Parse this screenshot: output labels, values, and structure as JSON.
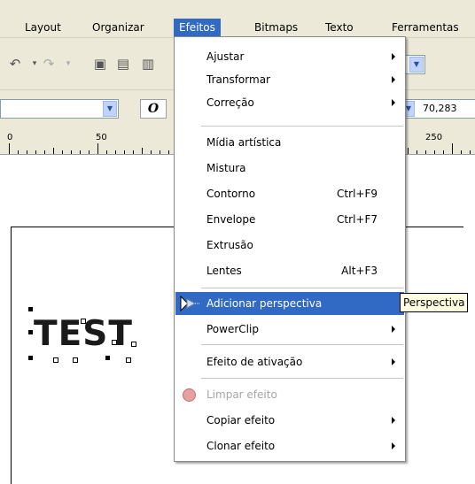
{
  "menubar": {
    "items": [
      {
        "label": "Layout"
      },
      {
        "label": "Organizar"
      },
      {
        "label": "Efeitos"
      },
      {
        "label": "Bitmaps"
      },
      {
        "label": "Texto"
      },
      {
        "label": "Ferramentas"
      }
    ]
  },
  "toolbar": {
    "width_value": "70,283",
    "italic_label": "O",
    "undo_icon": "undo-icon",
    "redo_icon": "redo-icon"
  },
  "ruler": {
    "labels": [
      "0",
      "50",
      "250"
    ]
  },
  "canvas": {
    "text": "TEST"
  },
  "menu": {
    "items": [
      {
        "label": "Ajustar",
        "shortcut": "",
        "submenu": true
      },
      {
        "label": "Transformar",
        "shortcut": "",
        "submenu": true
      },
      {
        "label": "Correção",
        "shortcut": "",
        "submenu": true
      },
      {
        "label": "Mídia artística",
        "shortcut": "",
        "submenu": false
      },
      {
        "label": "Mistura",
        "shortcut": "",
        "submenu": false
      },
      {
        "label": "Contorno",
        "shortcut": "Ctrl+F9",
        "submenu": false
      },
      {
        "label": "Envelope",
        "shortcut": "Ctrl+F7",
        "submenu": false
      },
      {
        "label": "Extrusão",
        "shortcut": "",
        "submenu": false
      },
      {
        "label": "Lentes",
        "shortcut": "Alt+F3",
        "submenu": false
      },
      {
        "label": "Adicionar perspectiva",
        "shortcut": "",
        "submenu": false,
        "highlighted": true
      },
      {
        "label": "PowerClip",
        "shortcut": "",
        "submenu": true
      },
      {
        "label": "Efeito de ativação",
        "shortcut": "",
        "submenu": true
      },
      {
        "label": "Limpar efeito",
        "shortcut": "",
        "submenu": false,
        "disabled": true
      },
      {
        "label": "Copiar efeito",
        "shortcut": "",
        "submenu": true
      },
      {
        "label": "Clonar efeito",
        "shortcut": "",
        "submenu": true
      }
    ]
  },
  "tooltip": {
    "text": "Perspectiva"
  },
  "colors": {
    "highlight": "#316ac5",
    "menubar_bg": "#ece9d8",
    "tooltip_bg": "#ffffe1"
  }
}
